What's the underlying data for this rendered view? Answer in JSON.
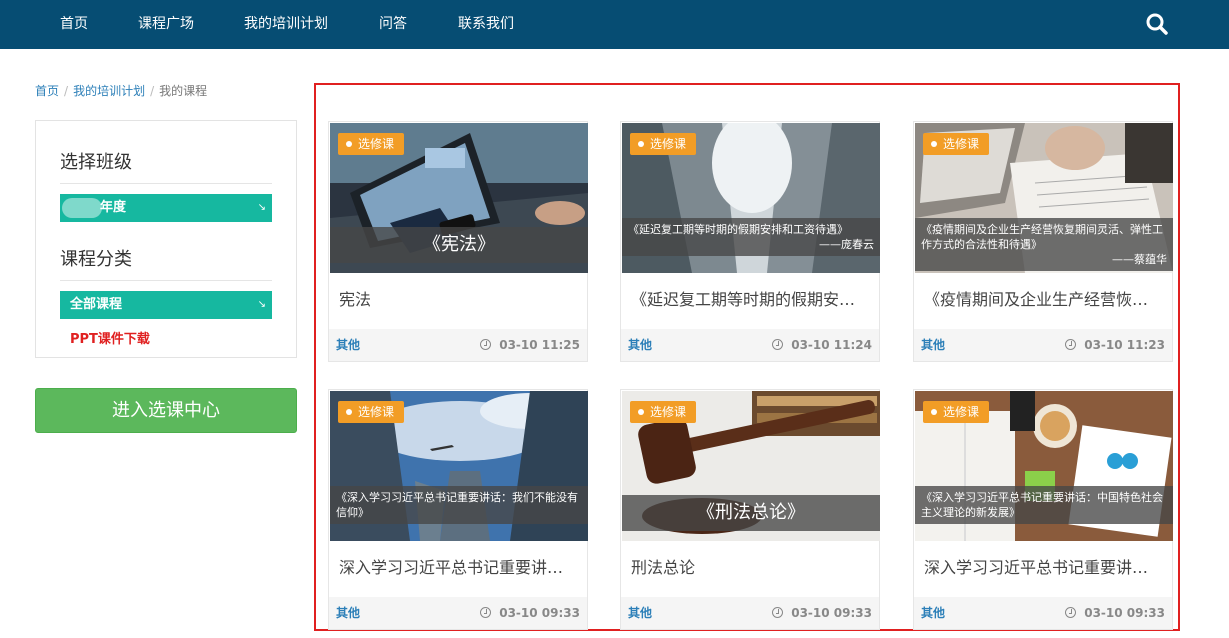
{
  "nav": {
    "items": [
      {
        "label": "首页"
      },
      {
        "label": "课程广场"
      },
      {
        "label": "我的培训计划"
      },
      {
        "label": "问答"
      },
      {
        "label": "联系我们"
      }
    ],
    "search_icon": "search-icon"
  },
  "breadcrumb": {
    "items": [
      "首页",
      "我的培训计划",
      "我的课程"
    ],
    "separator": "/"
  },
  "sidebar": {
    "class_title": "选择班级",
    "class_select": "年度",
    "category_title": "课程分类",
    "category_select": "全部课程",
    "ppt_link": "PPT课件下载",
    "select_arrow": "↘",
    "enter_button": "进入选课中心"
  },
  "courses": [
    {
      "tag": "选修课",
      "banner_title": "《宪法》",
      "banner_author": "",
      "title": "宪法",
      "category": "其他",
      "time": "03-10 11:25"
    },
    {
      "tag": "选修课",
      "banner_title": "《延迟复工期等时期的假期安排和工资待遇》",
      "banner_author": "——庞春云",
      "title": "《延迟复工期等时期的假期安排和工资待遇》",
      "category": "其他",
      "time": "03-10 11:24"
    },
    {
      "tag": "选修课",
      "banner_title": "《疫情期间及企业生产经营恢复期间灵活、弹性工作方式的合法性和待遇》",
      "banner_author": "——蔡蕴华",
      "title": "《疫情期间及企业生产经营恢复期间灵活、弹性工作方式的合法性和待遇》",
      "category": "其他",
      "time": "03-10 11:23"
    },
    {
      "tag": "选修课",
      "banner_title": "《深入学习习近平总书记重要讲话：我们不能没有信仰》",
      "banner_author": "",
      "title": "深入学习习近平总书记重要讲话：我们不能没有信仰",
      "category": "其他",
      "time": "03-10 09:33"
    },
    {
      "tag": "选修课",
      "banner_title": "《刑法总论》",
      "banner_author": "",
      "title": "刑法总论",
      "category": "其他",
      "time": "03-10 09:33"
    },
    {
      "tag": "选修课",
      "banner_title": "《深入学习习近平总书记重要讲话：中国特色社会主义理论的新发展》",
      "banner_author": "",
      "title": "深入学习习近平总书记重要讲话：中国特色社会主义理论的新发展",
      "category": "其他",
      "time": "03-10 09:33"
    }
  ],
  "colors": {
    "nav_bg": "#064d73",
    "select_bg": "#16b8a0",
    "tag_bg": "#f29d26",
    "enter_button_bg": "#5cb85c",
    "highlight_border": "#e02020",
    "link": "#2c7fb8"
  }
}
